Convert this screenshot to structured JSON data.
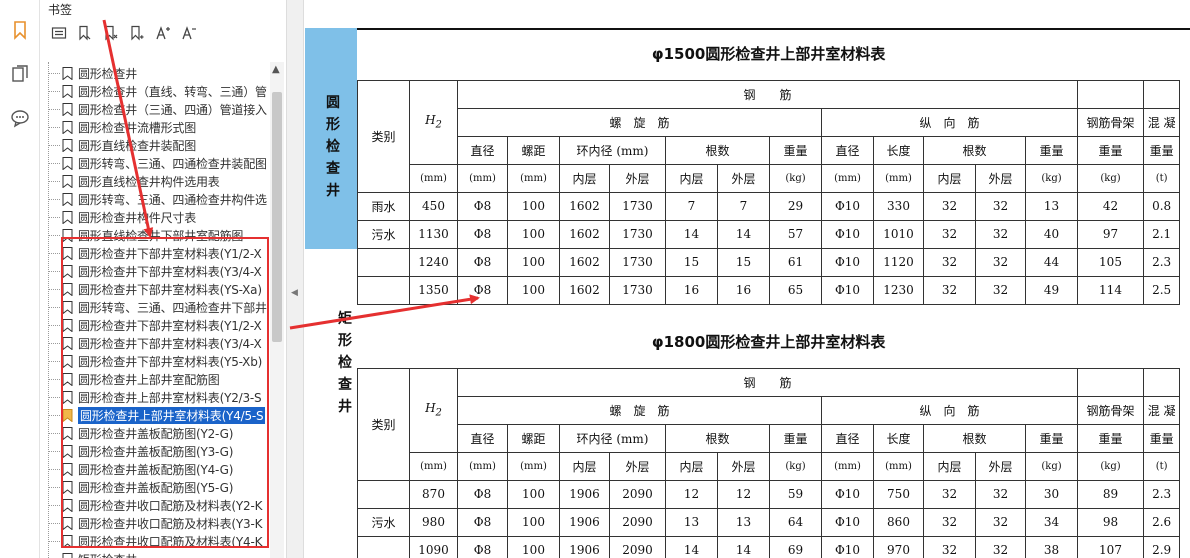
{
  "panel": {
    "title": "书签",
    "tools": [
      "expand-list-icon",
      "bookmark-add-icon",
      "bookmark-delete-icon",
      "bookmark-properties-icon",
      "font-increase-icon",
      "font-decrease-icon"
    ]
  },
  "bookmarks": [
    {
      "label": "圆形检查井",
      "selected": false
    },
    {
      "label": "圆形检查井（直线、转弯、三通）管",
      "selected": false
    },
    {
      "label": "圆形检查井（三通、四通）管道接入",
      "selected": false
    },
    {
      "label": "圆形检查井流槽形式图",
      "selected": false
    },
    {
      "label": "圆形直线检查井装配图",
      "selected": false
    },
    {
      "label": "圆形转弯、三通、四通检查井装配图",
      "selected": false
    },
    {
      "label": "圆形直线检查井构件选用表",
      "selected": false
    },
    {
      "label": "圆形转弯、三通、四通检查井构件选",
      "selected": false
    },
    {
      "label": "圆形检查井构件尺寸表",
      "selected": false
    },
    {
      "label": "圆形直线检查井下部井室配筋图",
      "selected": false
    },
    {
      "label": "圆形检查井下部井室材料表(Y1/2-X",
      "selected": false
    },
    {
      "label": "圆形检查井下部井室材料表(Y3/4-X",
      "selected": false
    },
    {
      "label": "圆形检查井下部井室材料表(YS-Xa)",
      "selected": false
    },
    {
      "label": "圆形转弯、三通、四通检查井下部井",
      "selected": false
    },
    {
      "label": "圆形检查井下部井室材料表(Y1/2-X",
      "selected": false
    },
    {
      "label": "圆形检查井下部井室材料表(Y3/4-X",
      "selected": false
    },
    {
      "label": "圆形检查井下部井室材料表(Y5-Xb)",
      "selected": false
    },
    {
      "label": "圆形检查井上部井室配筋图",
      "selected": false
    },
    {
      "label": "圆形检查井上部井室材料表(Y2/3-S",
      "selected": false
    },
    {
      "label": "圆形检查井上部井室材料表(Y4/5-S",
      "selected": true
    },
    {
      "label": "圆形检查井盖板配筋图(Y2-G)",
      "selected": false
    },
    {
      "label": "圆形检查井盖板配筋图(Y3-G)",
      "selected": false
    },
    {
      "label": "圆形检查井盖板配筋图(Y4-G)",
      "selected": false
    },
    {
      "label": "圆形检查井盖板配筋图(Y5-G)",
      "selected": false
    },
    {
      "label": "圆形检查井收口配筋及材料表(Y2-K",
      "selected": false
    },
    {
      "label": "圆形检查井收口配筋及材料表(Y3-K",
      "selected": false
    },
    {
      "label": "圆形检查井收口配筋及材料表(Y4-K",
      "selected": false
    },
    {
      "label": "矩形检查井",
      "selected": false
    }
  ],
  "side_labels": {
    "circle": [
      "圆",
      "形",
      "检",
      "查",
      "井"
    ],
    "rect": [
      "矩",
      "形",
      "检",
      "查",
      "井"
    ]
  },
  "headers": {
    "category": "类别",
    "h2": "H",
    "h2_sub": "2",
    "steel": "钢　　筋",
    "spiral": "螺　旋　筋",
    "longitudinal": "纵　向　筋",
    "cage": "钢筋骨架",
    "concrete": "混 凝",
    "diameter": "直径",
    "pitch": "螺距",
    "ring_dia": "环内径 (mm)",
    "count": "根数",
    "weight": "重量",
    "length": "长度",
    "inner": "内层",
    "outer": "外层",
    "concrete_weight": "重量",
    "unit_mm": "(mm)",
    "unit_kg": "(kg)",
    "unit_t": "(t)"
  },
  "table1": {
    "title": "φ1500圆形检查井上部井室材料表",
    "rows": [
      {
        "cat": "雨水",
        "h2": "450",
        "dia": "Φ8",
        "pitch": "100",
        "rin": "1602",
        "rout": "1730",
        "cin": "7",
        "cout": "7",
        "w": "29",
        "ldia": "Φ10",
        "len": "330",
        "lin": "32",
        "lout": "32",
        "lw": "13",
        "cage": "42",
        "conc": "0.8"
      },
      {
        "cat": "污水",
        "h2": "1130",
        "dia": "Φ8",
        "pitch": "100",
        "rin": "1602",
        "rout": "1730",
        "cin": "14",
        "cout": "14",
        "w": "57",
        "ldia": "Φ10",
        "len": "1010",
        "lin": "32",
        "lout": "32",
        "lw": "40",
        "cage": "97",
        "conc": "2.1"
      },
      {
        "cat": "",
        "h2": "1240",
        "dia": "Φ8",
        "pitch": "100",
        "rin": "1602",
        "rout": "1730",
        "cin": "15",
        "cout": "15",
        "w": "61",
        "ldia": "Φ10",
        "len": "1120",
        "lin": "32",
        "lout": "32",
        "lw": "44",
        "cage": "105",
        "conc": "2.3"
      },
      {
        "cat": "",
        "h2": "1350",
        "dia": "Φ8",
        "pitch": "100",
        "rin": "1602",
        "rout": "1730",
        "cin": "16",
        "cout": "16",
        "w": "65",
        "ldia": "Φ10",
        "len": "1230",
        "lin": "32",
        "lout": "32",
        "lw": "49",
        "cage": "114",
        "conc": "2.5"
      }
    ]
  },
  "table2": {
    "title": "φ1800圆形检查井上部井室材料表",
    "rows": [
      {
        "cat": "",
        "h2": "870",
        "dia": "Φ8",
        "pitch": "100",
        "rin": "1906",
        "rout": "2090",
        "cin": "12",
        "cout": "12",
        "w": "59",
        "ldia": "Φ10",
        "len": "750",
        "lin": "32",
        "lout": "32",
        "lw": "30",
        "cage": "89",
        "conc": "2.3"
      },
      {
        "cat": "污水",
        "h2": "980",
        "dia": "Φ8",
        "pitch": "100",
        "rin": "1906",
        "rout": "2090",
        "cin": "13",
        "cout": "13",
        "w": "64",
        "ldia": "Φ10",
        "len": "860",
        "lin": "32",
        "lout": "32",
        "lw": "34",
        "cage": "98",
        "conc": "2.6"
      },
      {
        "cat": "",
        "h2": "1090",
        "dia": "Φ8",
        "pitch": "100",
        "rin": "1906",
        "rout": "2090",
        "cin": "14",
        "cout": "14",
        "w": "69",
        "ldia": "Φ10",
        "len": "970",
        "lin": "32",
        "lout": "32",
        "lw": "38",
        "cage": "107",
        "conc": "2.9"
      }
    ]
  },
  "colors": {
    "accent_blue": "#1a63c9",
    "annotation_red": "#e53030",
    "doc_sidebar_blue": "#7fc0e8"
  }
}
